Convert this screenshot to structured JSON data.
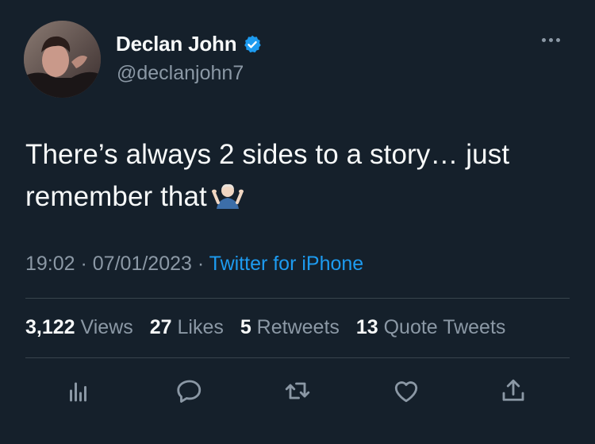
{
  "author": {
    "display_name": "Declan John",
    "handle": "@declanjohn7",
    "verified": true,
    "avatar_icon": "profile-photo"
  },
  "tweet": {
    "text": "There’s always 2 sides to a story… just remember that",
    "emoji": "man-shrugging-emoji"
  },
  "meta": {
    "time": "19:02",
    "sep1": " · ",
    "date": "07/01/2023",
    "sep2": " · ",
    "source": "Twitter for iPhone"
  },
  "stats": {
    "views_count": "3,122",
    "views_label": "Views",
    "likes_count": "27",
    "likes_label": "Likes",
    "retweets_count": "5",
    "retweets_label": "Retweets",
    "quotes_count": "13",
    "quotes_label": "Quote Tweets"
  },
  "actions": [
    "analytics-icon",
    "reply-icon",
    "retweet-icon",
    "like-icon",
    "share-icon"
  ],
  "colors": {
    "background": "#15202b",
    "accent": "#1d9bf0",
    "muted": "#8b98a5",
    "text": "#f7f9f9",
    "divider": "#38444d"
  }
}
